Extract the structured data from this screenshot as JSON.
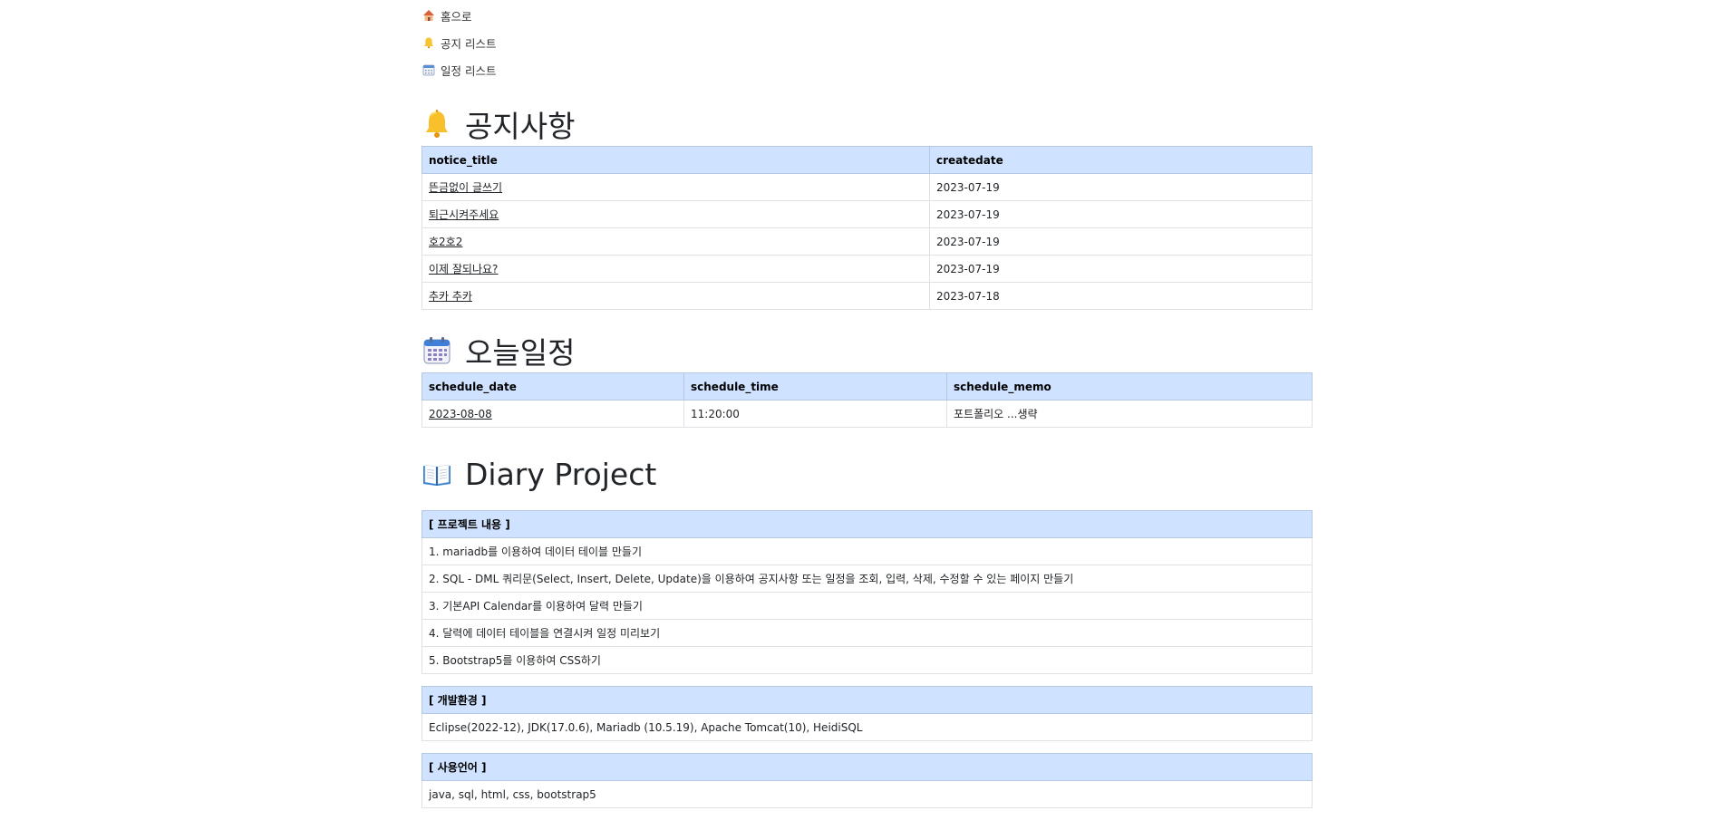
{
  "nav": [
    {
      "label": "홈으로",
      "icon": "house-icon"
    },
    {
      "label": "공지 리스트",
      "icon": "bell-icon"
    },
    {
      "label": "일정 리스트",
      "icon": "calendar-icon"
    }
  ],
  "notice": {
    "title": "공지사항",
    "icon": "bell-icon",
    "columns": [
      "notice_title",
      "createdate"
    ],
    "rows": [
      {
        "title": "뜬금없이 글쓰기",
        "date": "2023-07-19"
      },
      {
        "title": "퇴근시켜주세요",
        "date": "2023-07-19"
      },
      {
        "title": "호2호2",
        "date": "2023-07-19"
      },
      {
        "title": "이제 잘되나요?",
        "date": "2023-07-19"
      },
      {
        "title": "추카 추카",
        "date": "2023-07-18"
      }
    ]
  },
  "schedule": {
    "title": "오늘일정",
    "icon": "calendar-icon",
    "columns": [
      "schedule_date",
      "schedule_time",
      "schedule_memo"
    ],
    "rows": [
      {
        "date": "2023-08-08",
        "time": "11:20:00",
        "memo": "포트폴리오 ...생략"
      }
    ]
  },
  "project": {
    "title": "Diary Project",
    "icon": "open-book-icon",
    "content_header": "[ 프로젝트 내용 ]",
    "content_items": [
      "1. mariadb를 이용하여 데이터 테이블 만들기",
      "2. SQL - DML 쿼리문(Select, Insert, Delete, Update)을 이용하여 공지사항 또는 일정을 조회, 입력, 삭제, 수정할 수 있는 페이지 만들기",
      "3. 기본API Calendar를 이용하여 달력 만들기",
      "4. 달력에 데이터 테이블을 연결시켜 일정 미리보기",
      "5. Bootstrap5를 이용하여 CSS하기"
    ],
    "env_header": "[ 개발환경 ]",
    "env_value": "Eclipse(2022-12), JDK(17.0.6), Mariadb (10.5.19), Apache Tomcat(10), HeidiSQL",
    "lang_header": "[ 사용언어 ]",
    "lang_value": "java, sql, html, css, bootstrap5"
  }
}
